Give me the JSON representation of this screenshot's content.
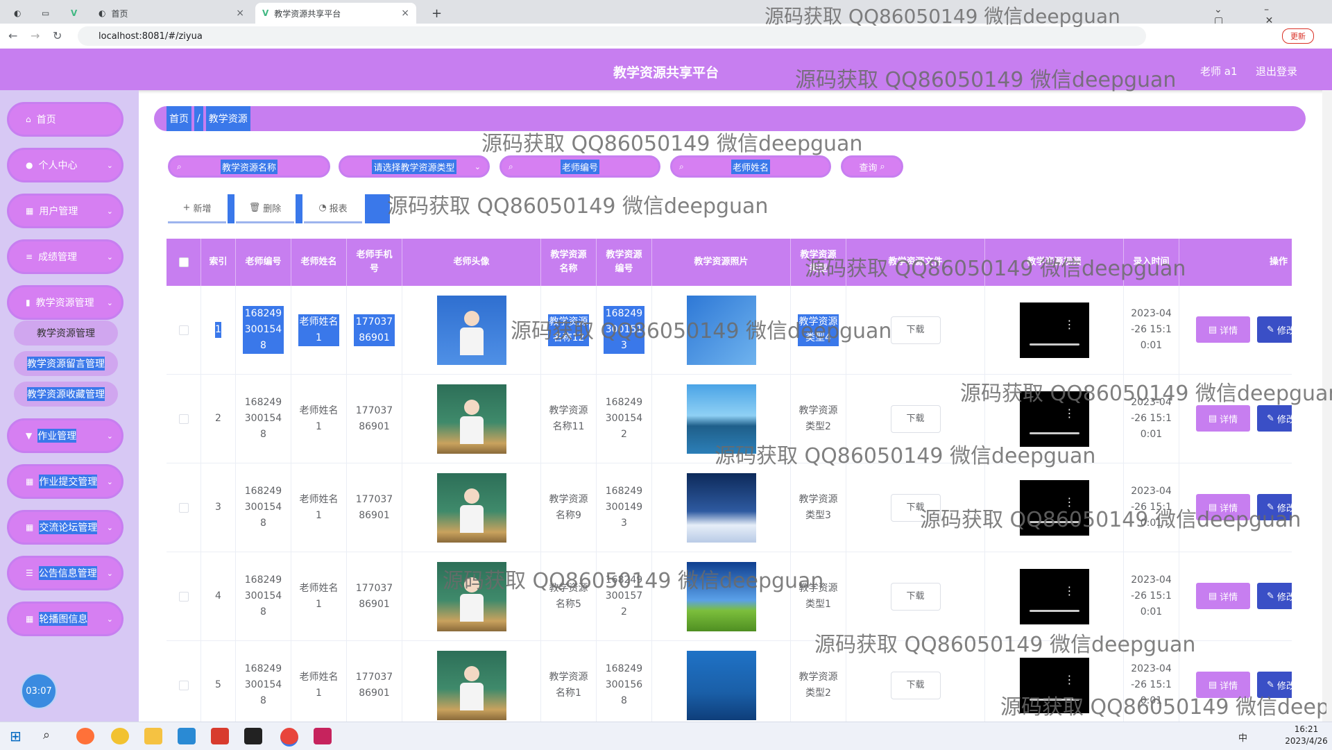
{
  "browser": {
    "tabs": [
      {
        "label": "首页",
        "active": false
      },
      {
        "label": "教学资源共享平台",
        "active": true
      }
    ],
    "new_tab": "+",
    "url": "localhost:8081/#/ziyua",
    "update_label": "更新"
  },
  "header": {
    "title": "教学资源共享平台",
    "user": "老师 a1",
    "logout": "退出登录"
  },
  "sidebar": {
    "items": [
      {
        "label": "首页",
        "icon": "home-icon",
        "has_children": false
      },
      {
        "label": "个人中心",
        "icon": "user-icon",
        "has_children": true
      },
      {
        "label": "用户管理",
        "icon": "grid-icon",
        "has_children": true
      },
      {
        "label": "成绩管理",
        "icon": "sliders-icon",
        "has_children": true
      },
      {
        "label": "教学资源管理",
        "icon": "chart-icon",
        "has_children": true
      },
      {
        "label": "作业管理",
        "icon": "pin-icon",
        "has_children": true
      },
      {
        "label": "作业提交管理",
        "icon": "grid-icon",
        "has_children": true
      },
      {
        "label": "交流论坛管理",
        "icon": "grid-icon",
        "has_children": true
      },
      {
        "label": "公告信息管理",
        "icon": "list-icon",
        "has_children": true
      },
      {
        "label": "轮播图信息",
        "icon": "grid-icon",
        "has_children": true
      }
    ],
    "submenu": [
      "教学资源管理",
      "教学资源留言管理",
      "教学资源收藏管理"
    ],
    "clock": "03:07"
  },
  "breadcrumb": {
    "home": "首页",
    "sep": "/",
    "current": "教学资源"
  },
  "filters": {
    "resource_name": "教学资源名称",
    "resource_type": "请选择教学资源类型",
    "teacher_id": "老师编号",
    "teacher_name": "老师姓名",
    "query": "查询"
  },
  "actions": {
    "add": "新增",
    "delete": "删除",
    "report": "报表"
  },
  "table": {
    "headers": [
      "索引",
      "老师编号",
      "老师姓名",
      "老师手机号",
      "老师头像",
      "教学资源名称",
      "教学资源编号",
      "教学资源照片",
      "教学资源类型",
      "教学资源文件",
      "教学资源视频",
      "录入时间",
      "操作"
    ],
    "download_label": "下载",
    "detail_label": "详情",
    "edit_label": "修改",
    "rows": [
      {
        "index": "1",
        "teacher_id": "1682493001548",
        "teacher_name": "老师姓名1",
        "phone": "17703786901",
        "resource_name": "教学资源名称12",
        "resource_id": "1682493001513",
        "resource_type": "教学资源类型4",
        "time": "2023-04-26 15:10:01",
        "photo": "blue"
      },
      {
        "index": "2",
        "teacher_id": "1682493001548",
        "teacher_name": "老师姓名1",
        "phone": "17703786901",
        "resource_name": "教学资源名称11",
        "resource_id": "1682493001542",
        "resource_type": "教学资源类型2",
        "time": "2023-04-26 15:10:01",
        "photo": "lake"
      },
      {
        "index": "3",
        "teacher_id": "1682493001548",
        "teacher_name": "老师姓名1",
        "phone": "17703786901",
        "resource_name": "教学资源名称9",
        "resource_id": "1682493001493",
        "resource_type": "教学资源类型3",
        "time": "2023-04-26 15:10:01",
        "photo": "snow"
      },
      {
        "index": "4",
        "teacher_id": "1682493001548",
        "teacher_name": "老师姓名1",
        "phone": "17703786901",
        "resource_name": "教学资源名称5",
        "resource_id": "1682493001572",
        "resource_type": "教学资源类型1",
        "time": "2023-04-26 15:10:01",
        "photo": "meadow"
      },
      {
        "index": "5",
        "teacher_id": "1682493001548",
        "teacher_name": "老师姓名1",
        "phone": "17703786901",
        "resource_name": "教学资源名称1",
        "resource_id": "1682493001568",
        "resource_type": "教学资源类型2",
        "time": "2023-04-26 15:10:01",
        "photo": "sea"
      }
    ]
  },
  "watermark": "源码获取 QQ86050149 微信deepguan",
  "taskbar": {
    "time": "16:21",
    "date": "2023/4/26",
    "ime": "中"
  },
  "colors": {
    "primary": "#c77ef0",
    "selection": "#3a78ea",
    "sidebar_bg": "#d7c8f4",
    "edit": "#3a4fc6"
  }
}
